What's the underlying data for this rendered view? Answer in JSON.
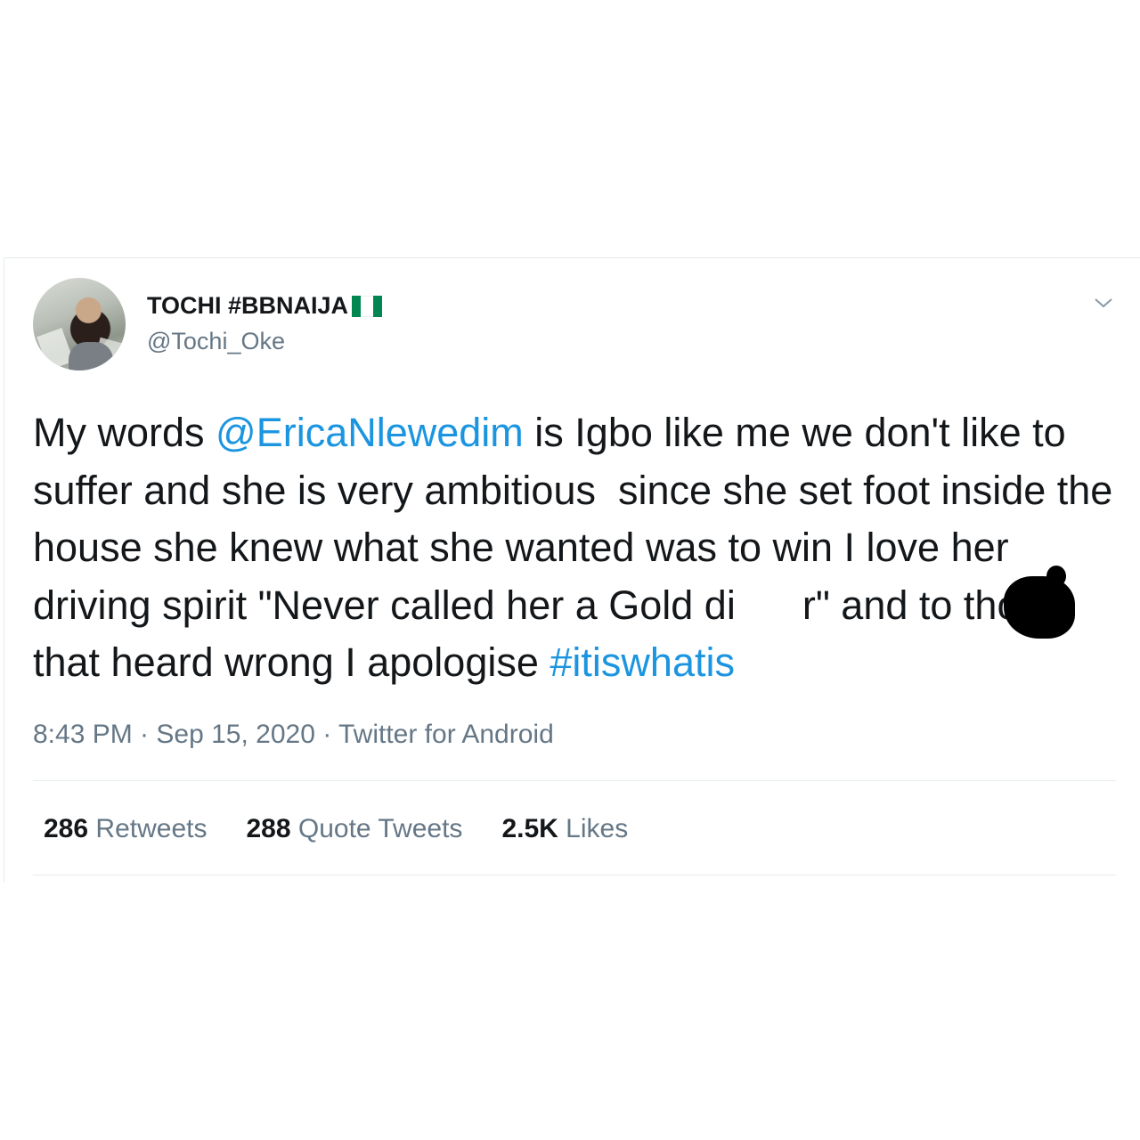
{
  "tweet": {
    "display_name": "TOCHI #BBNAIJA",
    "handle": "@Tochi_Oke",
    "text_parts": {
      "p1": "My words ",
      "mention": "@EricaNlewedim",
      "p2": " is Igbo like me we don't like to suffer and she is very ambitious  since she set foot inside the house she knew what she wanted was to win I love her driving spirit \"Never called her a Gold di",
      "p3": "r\" and to those that heard wrong I apologise ",
      "hashtag": "#itiswhatis"
    },
    "meta": "8:43 PM · Sep 15, 2020 · Twitter for Android",
    "stats": {
      "retweets_count": "286",
      "retweets_label": "Retweets",
      "quotes_count": "288",
      "quotes_label": "Quote Tweets",
      "likes_count": "2.5K",
      "likes_label": "Likes"
    }
  },
  "icons": {
    "flag": "nigeria-flag-icon",
    "menu": "chevron-down-icon"
  },
  "colors": {
    "link": "#1b95e0",
    "secondary_text": "#657786",
    "divider": "#e6ecf0",
    "flag_green": "#008751"
  }
}
